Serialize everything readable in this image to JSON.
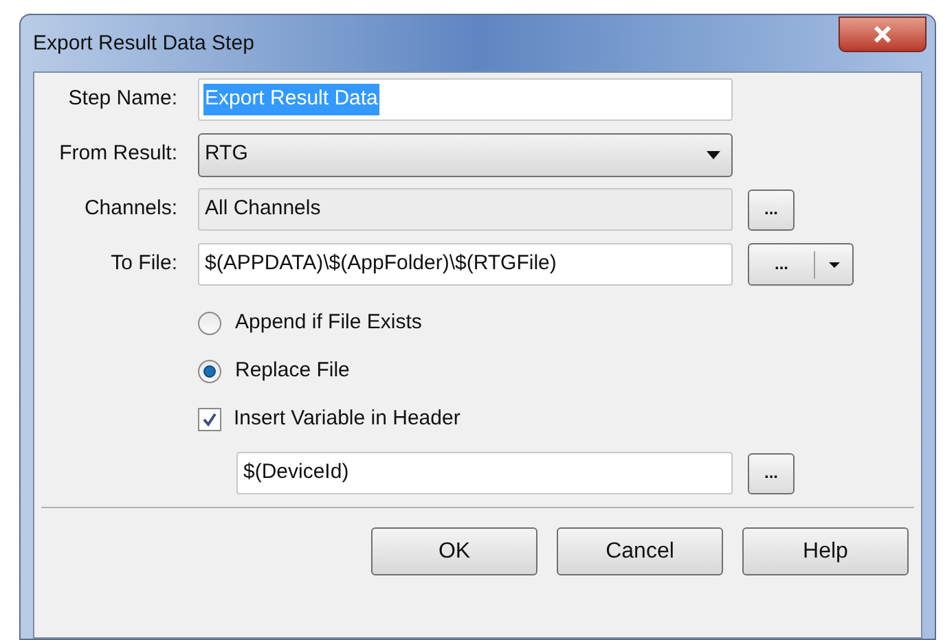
{
  "window": {
    "title": "Export Result Data Step"
  },
  "fields": [
    {
      "label": "Step Name:",
      "kind": "text",
      "value": "Export Result Data",
      "text_selected": true
    },
    {
      "label": "From Result:",
      "kind": "dropdown",
      "value": "RTG"
    },
    {
      "label": "Channels:",
      "kind": "readonly",
      "value": "All Channels",
      "browse_button": "..."
    },
    {
      "label": "To File:",
      "kind": "text",
      "value": "$(APPDATA)\\$(AppFolder)\\$(RTGFile)",
      "text_selected": false,
      "browse_button": "...",
      "has_menu": true
    }
  ],
  "file_modes": [
    {
      "label": "Append if File Exists",
      "selected": false
    },
    {
      "label": "Replace File",
      "selected": true
    }
  ],
  "insert_variable": {
    "label": "Insert Variable in Header",
    "checked": true,
    "value": "$(DeviceId)",
    "browse_button": "..."
  },
  "buttons": [
    "OK",
    "Cancel",
    "Help"
  ]
}
